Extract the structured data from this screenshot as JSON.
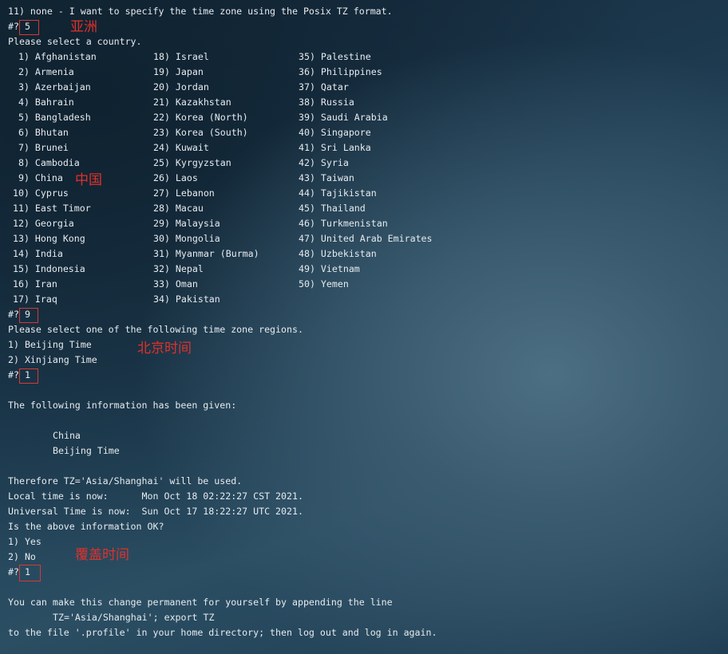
{
  "lines": {
    "posix_option": "11) none - I want to specify the time zone using the Posix TZ format.",
    "prompt": "#?",
    "select_country": "Please select a country.",
    "select_region": "Please select one of the following time zone regions.",
    "region_1": "1) Beijing Time",
    "region_2": "2) Xinjiang Time",
    "info_given": "The following information has been given:",
    "info_country": "China",
    "info_zone": "Beijing Time",
    "tz_used": "Therefore TZ='Asia/Shanghai' will be used.",
    "local_time": "Local time is now:      Mon Oct 18 02:22:27 CST 2021.",
    "universal_time": "Universal Time is now:  Sun Oct 17 18:22:27 UTC 2021.",
    "confirm_q": "Is the above information OK?",
    "confirm_yes": "1) Yes",
    "confirm_no": "2) No",
    "permanent_1": "You can make this change permanent for yourself by appending the line",
    "permanent_2": "TZ='Asia/Shanghai'; export TZ",
    "permanent_3": "to the file '.profile' in your home directory; then log out and log in again."
  },
  "inputs": {
    "continent": "5",
    "country": "9",
    "region": "1",
    "confirm": "1"
  },
  "countries": {
    "col1": [
      " 1) Afghanistan",
      " 2) Armenia",
      " 3) Azerbaijan",
      " 4) Bahrain",
      " 5) Bangladesh",
      " 6) Bhutan",
      " 7) Brunei",
      " 8) Cambodia",
      " 9) China",
      "10) Cyprus",
      "11) East Timor",
      "12) Georgia",
      "13) Hong Kong",
      "14) India",
      "15) Indonesia",
      "16) Iran",
      "17) Iraq"
    ],
    "col2": [
      "18) Israel",
      "19) Japan",
      "20) Jordan",
      "21) Kazakhstan",
      "22) Korea (North)",
      "23) Korea (South)",
      "24) Kuwait",
      "25) Kyrgyzstan",
      "26) Laos",
      "27) Lebanon",
      "28) Macau",
      "29) Malaysia",
      "30) Mongolia",
      "31) Myanmar (Burma)",
      "32) Nepal",
      "33) Oman",
      "34) Pakistan"
    ],
    "col3": [
      "35) Palestine",
      "36) Philippines",
      "37) Qatar",
      "38) Russia",
      "39) Saudi Arabia",
      "40) Singapore",
      "41) Sri Lanka",
      "42) Syria",
      "43) Taiwan",
      "44) Tajikistan",
      "45) Thailand",
      "46) Turkmenistan",
      "47) United Arab Emirates",
      "48) Uzbekistan",
      "49) Vietnam",
      "50) Yemen"
    ]
  },
  "annotations": {
    "asia": "亚洲",
    "china": "中国",
    "beijing_time": "北京时间",
    "overwrite_time": "覆盖时间"
  },
  "colors": {
    "annotation": "#e0312b",
    "text": "#e6ebef"
  }
}
